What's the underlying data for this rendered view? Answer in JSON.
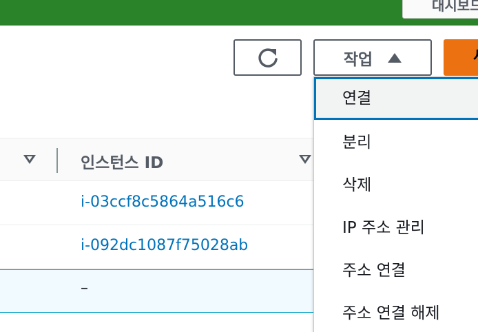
{
  "top_bar": {
    "button_label": "대시보드",
    "color": "#2a8229"
  },
  "toolbar": {
    "refresh_icon": "refresh-icon",
    "actions_label": "작업",
    "actions_icon": "caret-up-icon",
    "primary_label": "새로"
  },
  "table": {
    "column_header": "인스턴스 ID",
    "rows": [
      {
        "instance_id": "i-03ccf8c5864a516c6"
      },
      {
        "instance_id": "i-092dc1087f75028ab"
      },
      {
        "instance_id": "–"
      }
    ]
  },
  "actions_menu": {
    "items": [
      {
        "label": "연결"
      },
      {
        "label": "분리"
      },
      {
        "label": "삭제"
      },
      {
        "label": "IP 주소 관리"
      },
      {
        "label": "주소 연결"
      },
      {
        "label": "주소 연결 해제"
      }
    ]
  },
  "colors": {
    "link": "#0073bb",
    "focus_border": "#0073bb",
    "primary": "#ec7211"
  }
}
